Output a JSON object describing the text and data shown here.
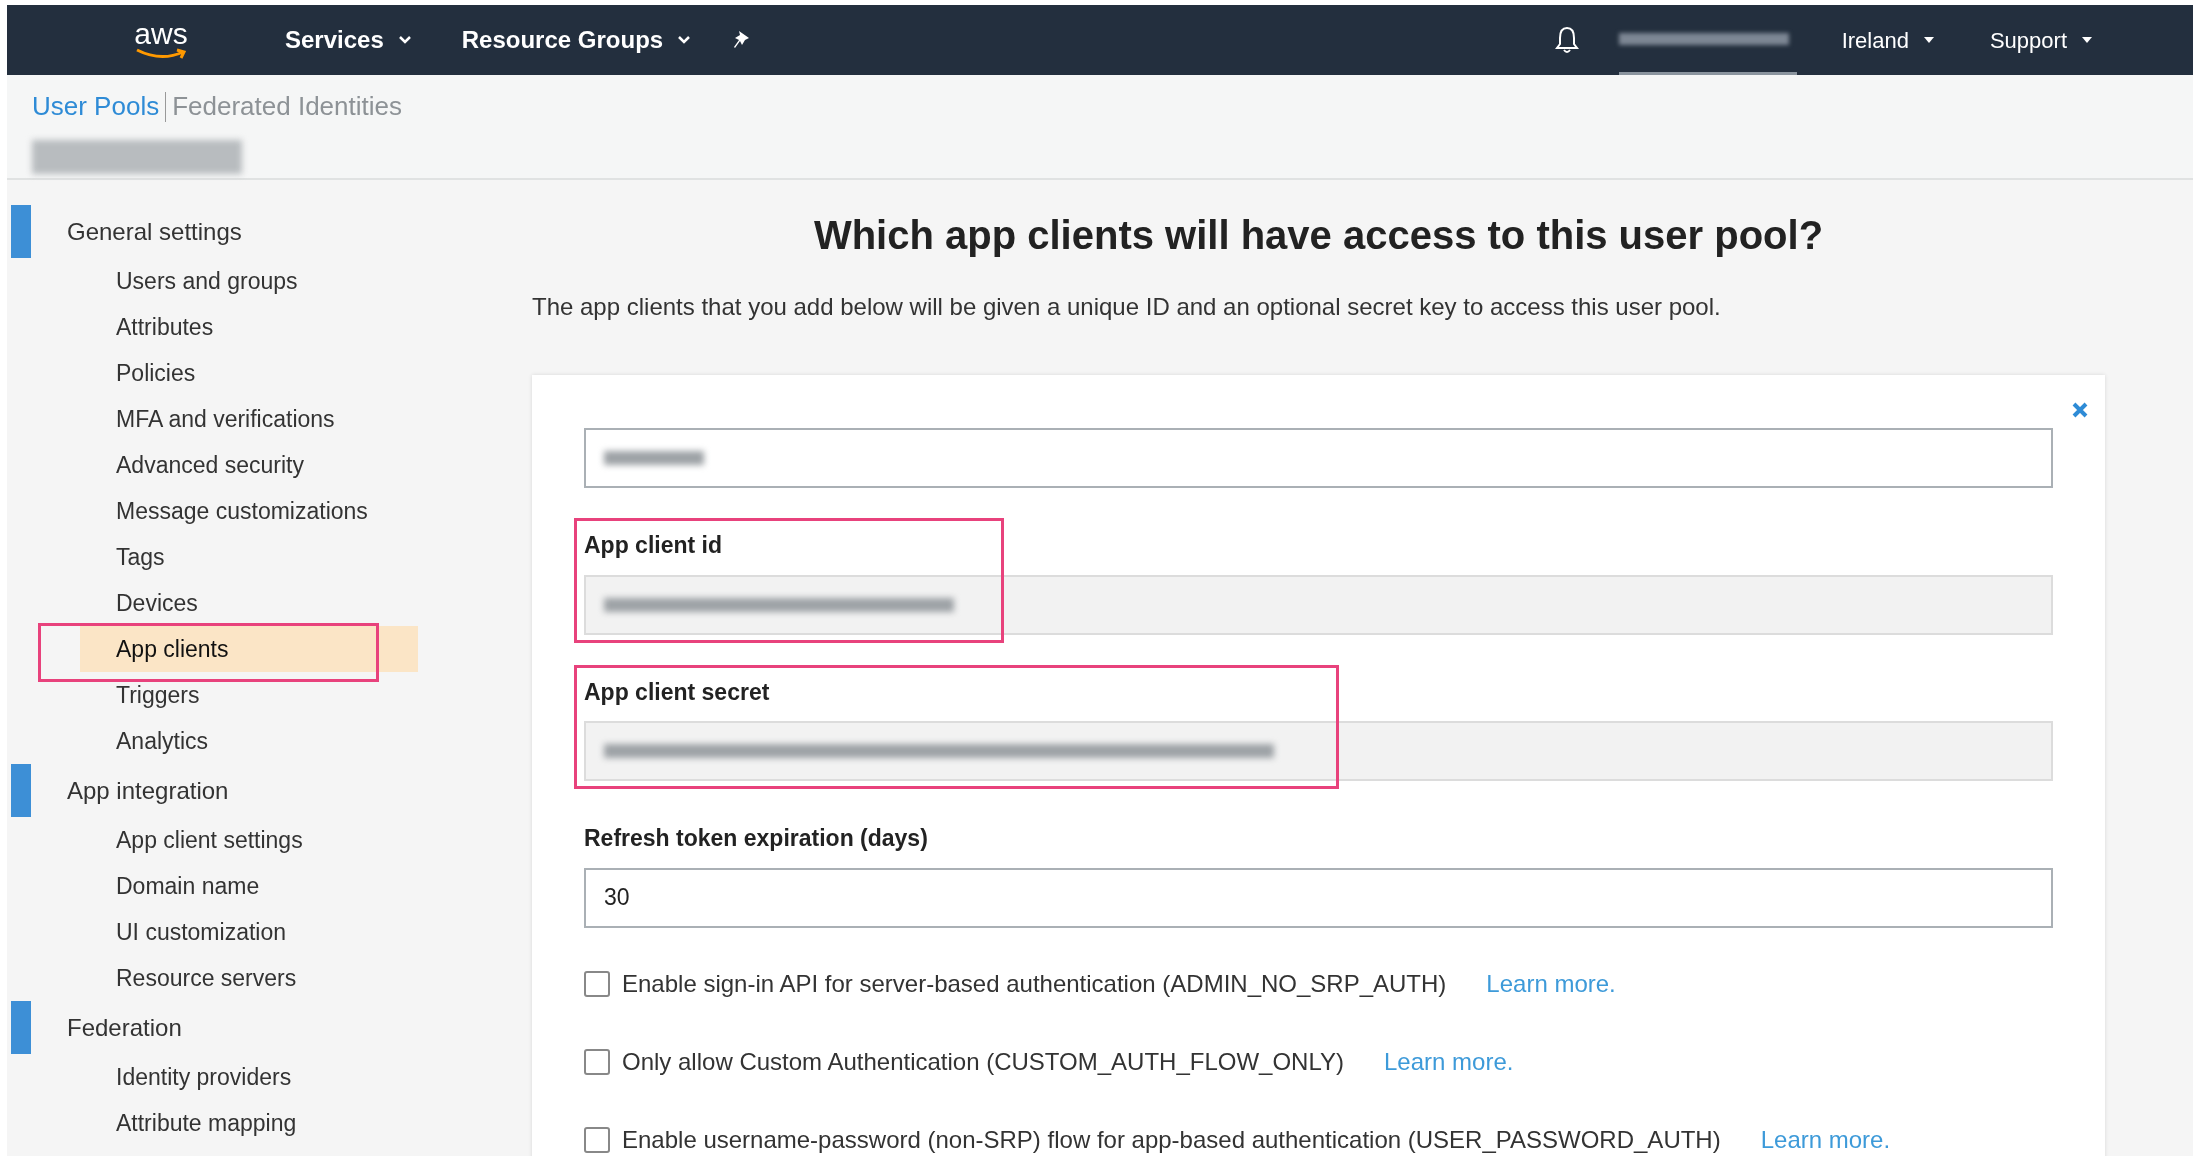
{
  "nav": {
    "logo": "aws",
    "menus": [
      {
        "label": "Services"
      },
      {
        "label": "Resource Groups"
      }
    ],
    "right_menus": [
      {
        "label": "Ireland"
      },
      {
        "label": "Support"
      }
    ]
  },
  "tabs": [
    {
      "label": "User Pools",
      "selected": true
    },
    {
      "label": "Federated Identities",
      "selected": false
    }
  ],
  "sidebar": {
    "sections": [
      {
        "title": "General settings",
        "items": [
          {
            "label": "Users and groups",
            "selected": false
          },
          {
            "label": "Attributes",
            "selected": false
          },
          {
            "label": "Policies",
            "selected": false
          },
          {
            "label": "MFA and verifications",
            "selected": false
          },
          {
            "label": "Advanced security",
            "selected": false
          },
          {
            "label": "Message customizations",
            "selected": false
          },
          {
            "label": "Tags",
            "selected": false
          },
          {
            "label": "Devices",
            "selected": false
          },
          {
            "label": "App clients",
            "selected": true,
            "highlighted": true
          },
          {
            "label": "Triggers",
            "selected": false
          },
          {
            "label": "Analytics",
            "selected": false
          }
        ]
      },
      {
        "title": "App integration",
        "items": [
          {
            "label": "App client settings",
            "selected": false
          },
          {
            "label": "Domain name",
            "selected": false
          },
          {
            "label": "UI customization",
            "selected": false
          },
          {
            "label": "Resource servers",
            "selected": false
          }
        ]
      },
      {
        "title": "Federation",
        "items": [
          {
            "label": "Identity providers",
            "selected": false
          },
          {
            "label": "Attribute mapping",
            "selected": false
          }
        ]
      }
    ]
  },
  "main": {
    "heading": "Which app clients will have access to this user pool?",
    "description": "The app clients that you add below will be given a unique ID and an optional secret key to access this user pool.",
    "form": {
      "fields": [
        {
          "kind": "redacted",
          "readonly": false,
          "highlighted": false
        },
        {
          "kind": "redacted",
          "label": "App client id",
          "readonly": true,
          "highlighted": true
        },
        {
          "kind": "redacted",
          "label": "App client secret",
          "readonly": true,
          "highlighted": true
        },
        {
          "kind": "text",
          "label": "Refresh token expiration (days)",
          "value": "30",
          "readonly": false,
          "highlighted": false
        }
      ],
      "options": [
        {
          "label": "Enable sign-in API for server-based authentication (ADMIN_NO_SRP_AUTH)",
          "checked": false,
          "link": "Learn more."
        },
        {
          "label": "Only allow Custom Authentication (CUSTOM_AUTH_FLOW_ONLY)",
          "checked": false,
          "link": "Learn more."
        },
        {
          "label": "Enable username-password (non-SRP) flow for app-based authentication (USER_PASSWORD_AUTH)",
          "checked": false,
          "link": "Learn more."
        }
      ]
    }
  }
}
